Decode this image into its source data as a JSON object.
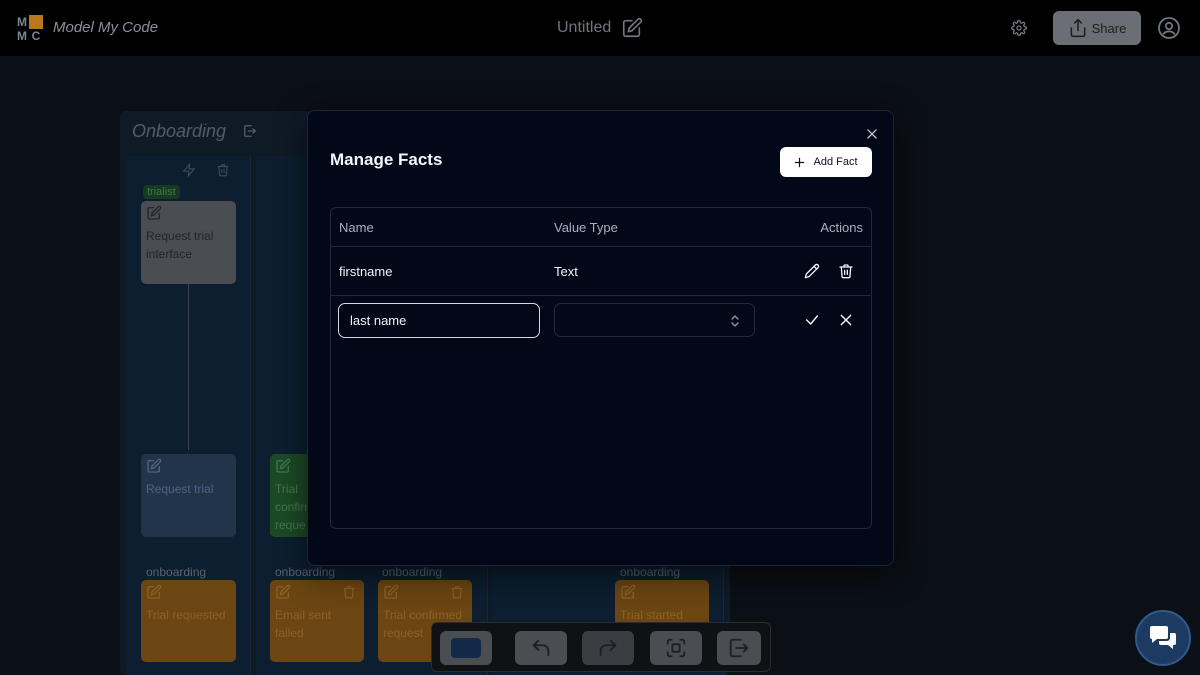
{
  "topbar": {
    "logo_letters": [
      "M",
      "M",
      "C"
    ],
    "app_name": "Model My Code",
    "doc_title": "Untitled",
    "share_label": "Share"
  },
  "board": {
    "title": "Onboarding",
    "tag": "trialist",
    "cards": {
      "request_trial_interface": "Request trial interface",
      "request_trial": "Request trial",
      "trial_confirm": "Trial confirm reque",
      "trial_requested": "Trial requested",
      "email_sent_failed": "Email sent failed",
      "trial_confirmed": "Trial confirmed request",
      "trial_started": "Trial started"
    },
    "lane_label": "onboarding"
  },
  "modal": {
    "title": "Manage Facts",
    "add_fact_label": "Add Fact",
    "columns": {
      "name": "Name",
      "value_type": "Value Type",
      "actions": "Actions"
    },
    "rows": [
      {
        "name": "firstname",
        "value_type": "Text"
      }
    ],
    "new_row": {
      "name_value": "last name",
      "value_type_value": ""
    }
  },
  "colors": {
    "modal_bg": "#020817",
    "card_orange": "#6b4512",
    "card_green": "#1c4a27",
    "accent_white": "#ffffff"
  }
}
